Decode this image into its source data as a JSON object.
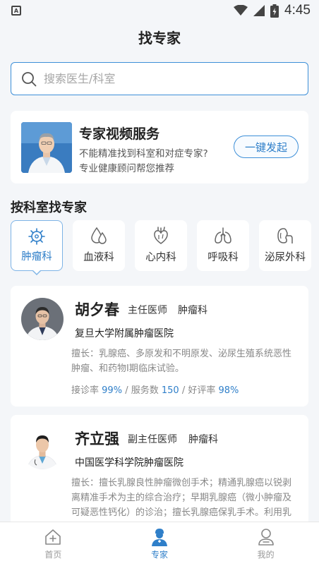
{
  "status": {
    "time": "4:45",
    "left_icon": "A"
  },
  "header": {
    "title": "找专家"
  },
  "search": {
    "placeholder": "搜索医生/科室"
  },
  "video_service": {
    "title": "专家视频服务",
    "line1": "不能精准找到科室和对症专家?",
    "line2": "专业健康顾问帮您推荐",
    "button": "一键发起"
  },
  "departments": {
    "section_title": "按科室找专家",
    "items": [
      {
        "label": "肿瘤科",
        "icon": "cell-icon",
        "active": true
      },
      {
        "label": "血液科",
        "icon": "blood-drop-icon",
        "active": false
      },
      {
        "label": "心内科",
        "icon": "heart-icon",
        "active": false
      },
      {
        "label": "呼吸科",
        "icon": "lungs-icon",
        "active": false
      },
      {
        "label": "泌尿外科",
        "icon": "kidney-icon",
        "active": false
      }
    ]
  },
  "doctors": [
    {
      "name": "胡夕春",
      "title": "主任医师",
      "dept": "肿瘤科",
      "hospital": "复旦大学附属肿瘤医院",
      "desc": "擅长：乳腺癌、多原发和不明原发、泌尿生殖系统恶性肿瘤、和药物I期临床试验。",
      "stats": {
        "accept_label": "接诊率",
        "accept_value": "99%",
        "service_label": "服务数",
        "service_value": "150",
        "rating_label": "好评率",
        "rating_value": "98%"
      }
    },
    {
      "name": "齐立强",
      "title": "副主任医师",
      "dept": "肿瘤科",
      "hospital": "中国医学科学院肿瘤医院",
      "desc": "擅长：擅长乳腺良性肿瘤微创手术；精通乳腺癌以锐剥离精准手术为主的综合治疗；早期乳腺癌（微小肿瘤及可疑恶性钙化）的诊治；擅长乳腺癌保乳手术。利用乳腺癌基因检测结果评估有家族史个体患癌风"
    }
  ],
  "tabbar": [
    {
      "label": "首页",
      "icon": "home-plus-icon",
      "active": false
    },
    {
      "label": "专家",
      "icon": "doctor-icon",
      "active": true
    },
    {
      "label": "我的",
      "icon": "user-icon",
      "active": false
    }
  ],
  "colors": {
    "accent": "#2f7fc9",
    "background": "#f4f6f9"
  }
}
